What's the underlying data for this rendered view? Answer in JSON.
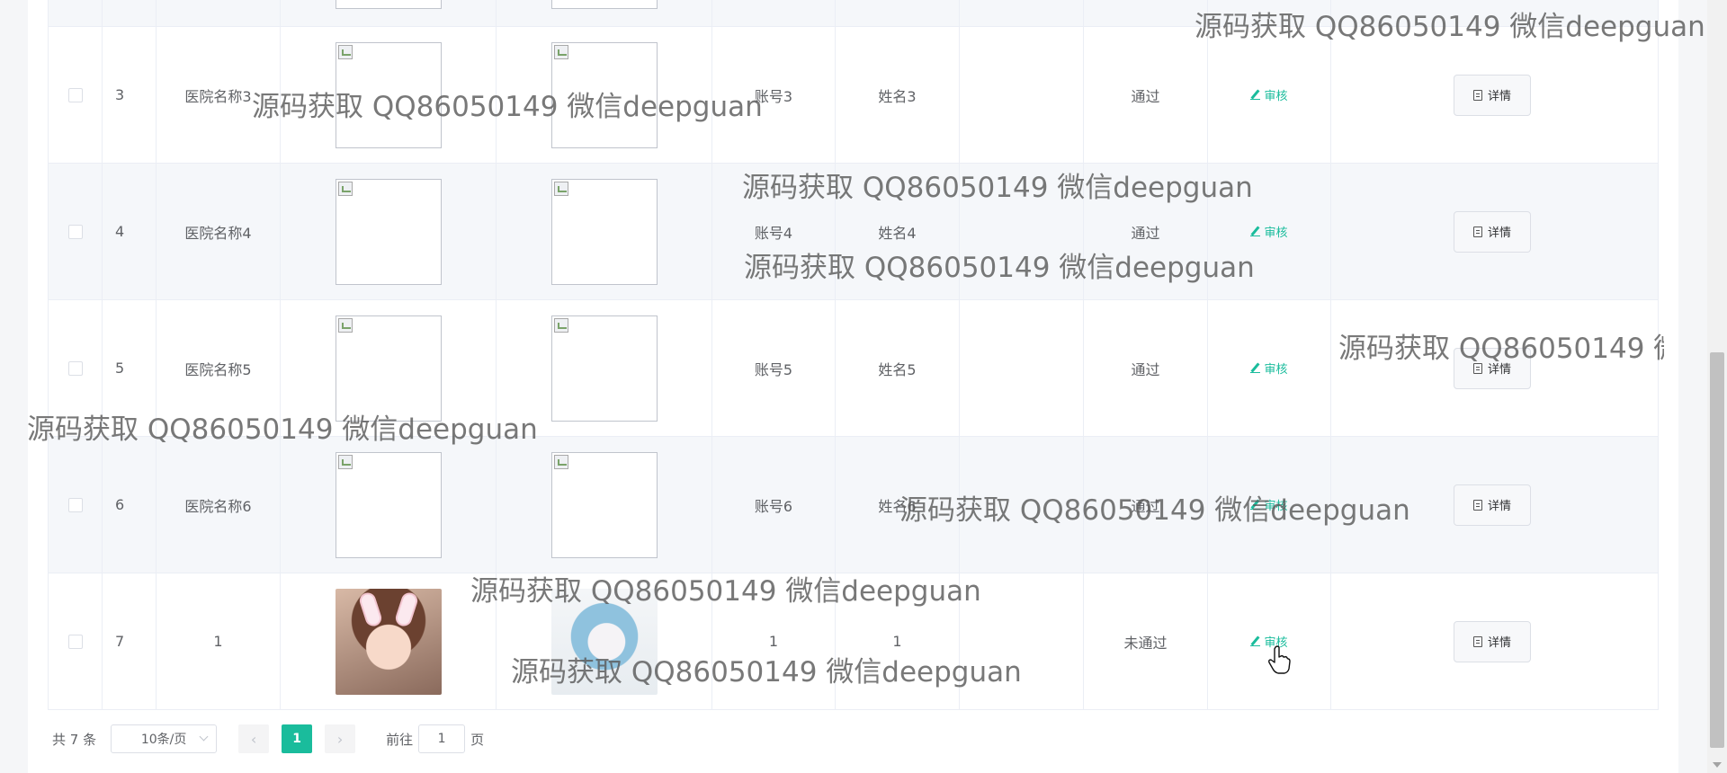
{
  "table": {
    "rows": [
      {
        "index": "3",
        "hospital": "医院名称3",
        "account": "账号3",
        "name": "姓名3",
        "status": "通过",
        "audit_label": "审核",
        "detail_label": "详情",
        "images": "broken"
      },
      {
        "index": "4",
        "hospital": "医院名称4",
        "account": "账号4",
        "name": "姓名4",
        "status": "通过",
        "audit_label": "审核",
        "detail_label": "详情",
        "images": "broken"
      },
      {
        "index": "5",
        "hospital": "医院名称5",
        "account": "账号5",
        "name": "姓名5",
        "status": "通过",
        "audit_label": "审核",
        "detail_label": "详情",
        "images": "broken"
      },
      {
        "index": "6",
        "hospital": "医院名称6",
        "account": "账号6",
        "name": "姓名6",
        "status": "通过",
        "audit_label": "审核",
        "detail_label": "详情",
        "images": "broken"
      },
      {
        "index": "7",
        "hospital": "1",
        "account": "1",
        "name": "1",
        "status": "未通过",
        "audit_label": "审核",
        "detail_label": "详情",
        "images": "photos"
      }
    ]
  },
  "pagination": {
    "total_text": "共 7 条",
    "page_size": "10条/页",
    "prev_icon": "‹",
    "next_icon": "›",
    "current_page": "1",
    "goto_prefix": "前往",
    "goto_value": "1",
    "goto_suffix": "页"
  },
  "watermark_text": "源码获取 QQ86050149 微信deepguan",
  "icons": {
    "audit": "pencil-icon",
    "detail": "doc-icon",
    "image_placeholder": "broken-image-icon",
    "cursor": "hand-pointer-icon"
  },
  "colors": {
    "accent": "#1abc9c",
    "stripe": "#f5f7fa",
    "border": "#ebeef5"
  }
}
